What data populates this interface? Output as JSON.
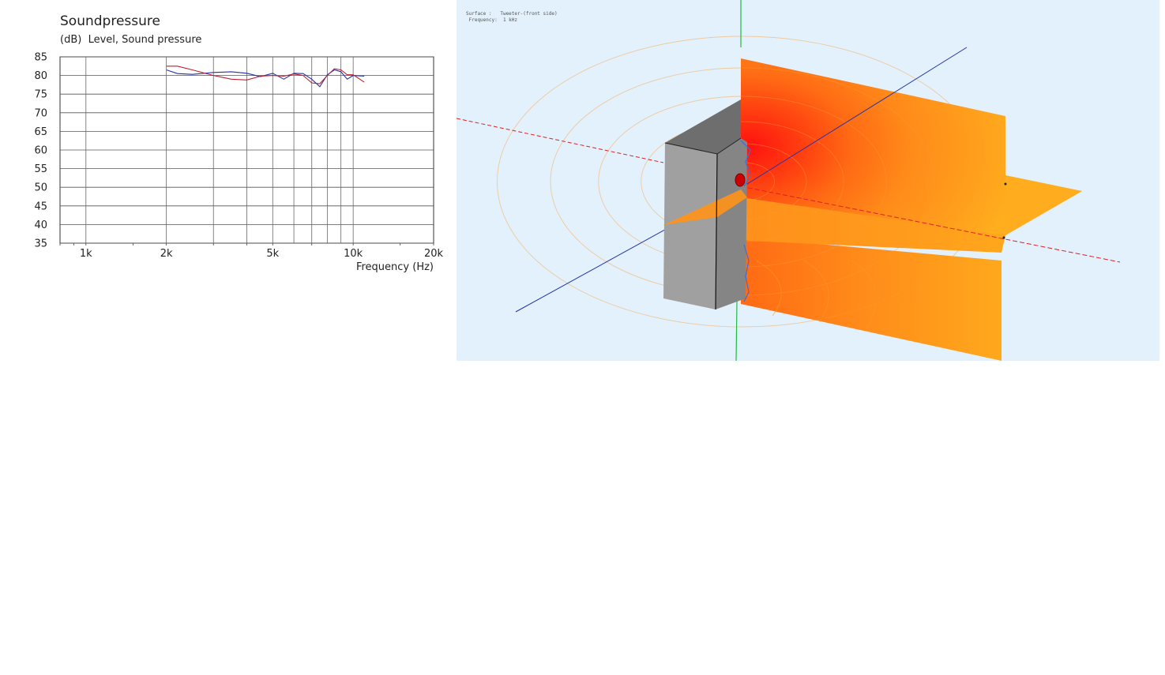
{
  "chart_data": {
    "type": "line",
    "title": "Soundpressure",
    "ylabel": "(dB)  Level, Sound pressure",
    "xlabel": "Frequency  (Hz)",
    "x_scale": "log",
    "xlim": [
      800,
      20000
    ],
    "ylim": [
      35,
      85
    ],
    "grid": true,
    "y_ticks": [
      85,
      80,
      75,
      70,
      65,
      60,
      55,
      50,
      45,
      40,
      35
    ],
    "x_tick_labels": [
      {
        "value": 1000,
        "label": "1k"
      },
      {
        "value": 2000,
        "label": "2k"
      },
      {
        "value": 5000,
        "label": "5k"
      },
      {
        "value": 10000,
        "label": "10k"
      },
      {
        "value": 20000,
        "label": "20k"
      }
    ],
    "x_gridlines": [
      1000,
      2000,
      3000,
      4000,
      5000,
      6000,
      7000,
      8000,
      9000,
      10000
    ],
    "series": [
      {
        "color": "#2233aa",
        "x": [
          2000,
          2200,
          2500,
          3000,
          3500,
          4000,
          4500,
          5000,
          5500,
          6000,
          6500,
          7000,
          7500,
          8000,
          8500,
          9000,
          9500,
          10000,
          11000
        ],
        "y": [
          81.5,
          80.5,
          80.3,
          80.8,
          81.0,
          80.6,
          79.7,
          80.6,
          79.0,
          80.6,
          80.5,
          79.0,
          77.0,
          80.2,
          81.5,
          81.0,
          79.0,
          80.0,
          79.8
        ]
      },
      {
        "color": "#bb2233",
        "x": [
          2000,
          2200,
          2500,
          3000,
          3500,
          4000,
          4500,
          5000,
          5500,
          6000,
          6500,
          7000,
          7500,
          8000,
          8500,
          9000,
          9500,
          10000,
          11000
        ],
        "y": [
          82.5,
          82.5,
          81.5,
          80.0,
          79.0,
          78.8,
          79.8,
          80.0,
          79.8,
          80.4,
          80.0,
          78.0,
          77.8,
          80.0,
          81.8,
          81.5,
          80.2,
          80.2,
          78.2
        ]
      }
    ]
  },
  "simulation": {
    "info_lines": [
      "Surface :   Tweeter-(front side)",
      " Frequency:  1 kHz"
    ],
    "colors": {
      "background": "#e2f1fb",
      "cabinet_top": "#6e6e6e",
      "cabinet_front": "#a0a0a0",
      "cabinet_side": "#858585",
      "field_max": "#ff1a1a",
      "field_mid": "#ff7a1a",
      "field_min": "#ffb000",
      "axis_x": "#dd2222",
      "axis_y": "#2233aa",
      "axis_z": "#22bb44"
    }
  }
}
